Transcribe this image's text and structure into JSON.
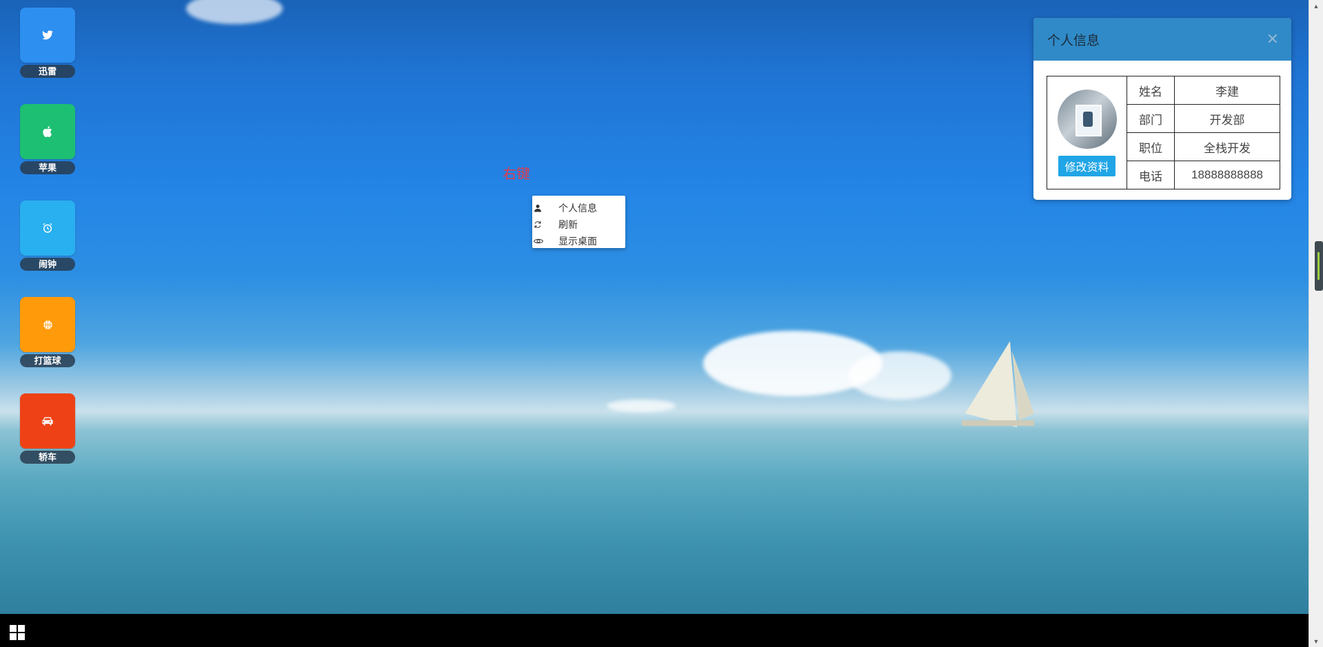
{
  "desktop_icons": [
    {
      "label": "迅雷",
      "icon": "twitter-bird-icon",
      "color": "#2d8ff0"
    },
    {
      "label": "苹果",
      "icon": "apple-icon",
      "color": "#1dbf72"
    },
    {
      "label": "闹钟",
      "icon": "alarm-clock-icon",
      "color": "#29b0f0"
    },
    {
      "label": "打篮球",
      "icon": "basketball-icon",
      "color": "#ff9a0a"
    },
    {
      "label": "轿车",
      "icon": "car-icon",
      "color": "#ee4216"
    }
  ],
  "right_click_hint": "右键",
  "context_menu": {
    "items": [
      {
        "label": "个人信息",
        "icon": "user-icon"
      },
      {
        "label": "刷新",
        "icon": "refresh-icon"
      },
      {
        "label": "显示桌面",
        "icon": "eye-icon"
      }
    ]
  },
  "info_panel": {
    "title": "个人信息",
    "close_icon": "close-icon",
    "edit_button": "修改资料",
    "rows": [
      {
        "key": "姓名",
        "value": "李建"
      },
      {
        "key": "部门",
        "value": "开发部"
      },
      {
        "key": "职位",
        "value": "全栈开发"
      },
      {
        "key": "电话",
        "value": "18888888888"
      }
    ]
  },
  "taskbar": {
    "start_icon": "windows-start-icon"
  }
}
